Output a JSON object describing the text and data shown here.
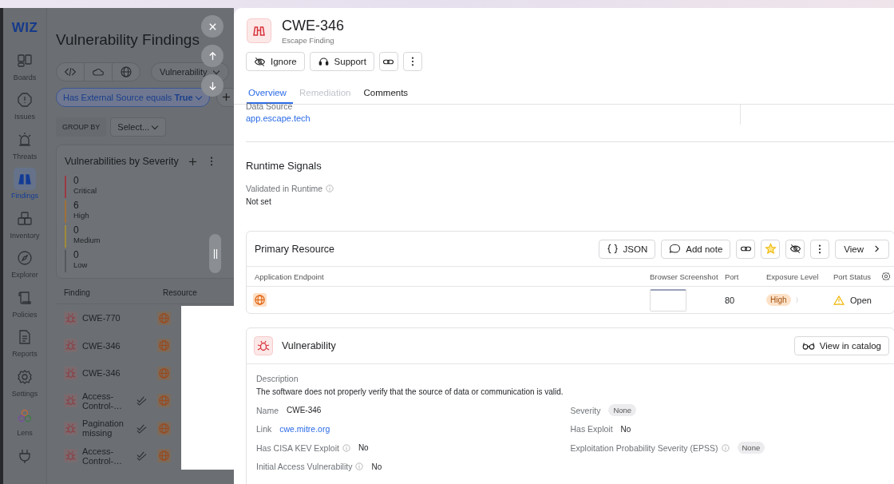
{
  "sidebar": {
    "logo": "WIZ",
    "items": [
      {
        "label": "Boards",
        "selected": false
      },
      {
        "label": "Issues",
        "selected": false
      },
      {
        "label": "Threats",
        "selected": false
      },
      {
        "label": "Findings",
        "selected": true
      },
      {
        "label": "Inventory",
        "selected": false
      },
      {
        "label": "Explorer",
        "selected": false
      },
      {
        "label": "Policies",
        "selected": false
      },
      {
        "label": "Reports",
        "selected": false
      },
      {
        "label": "Settings",
        "selected": false
      },
      {
        "label": "Lens",
        "selected": false
      },
      {
        "selected": false
      }
    ]
  },
  "page": {
    "title": "Vulnerability Findings",
    "type_filter": "Vulnerability",
    "filter_chip": "Has External Source equals **True**",
    "group_by_label": "GROUP BY",
    "group_by_value": "Select..."
  },
  "severity_card": {
    "title": "Vulnerabilities by Severity",
    "levels": [
      {
        "count": "0",
        "label": "Critical",
        "color": "#9b3a44"
      },
      {
        "count": "6",
        "label": "High",
        "color": "#a0703a"
      },
      {
        "count": "0",
        "label": "Medium",
        "color": "#a08a3a"
      },
      {
        "count": "0",
        "label": "Low",
        "color": "#55595e"
      }
    ]
  },
  "findings_table": {
    "columns": [
      "Finding",
      "Resource"
    ],
    "rows": [
      {
        "name": "CWE-770",
        "verified": false
      },
      {
        "name": "CWE-346",
        "verified": false
      },
      {
        "name": "CWE-346",
        "verified": false
      },
      {
        "name": "Access-Control-…",
        "verified": true
      },
      {
        "name": "Pagination missing",
        "verified": true
      },
      {
        "name": "Access-Control-…",
        "verified": true
      }
    ]
  },
  "drawer": {
    "title": "CWE-346",
    "subtitle": "Escape Finding",
    "actions": [
      "Ignore",
      "Support"
    ],
    "tabs": [
      {
        "label": "Overview",
        "selected": true,
        "disabled": false
      },
      {
        "label": "Remediation",
        "selected": false,
        "disabled": true
      },
      {
        "label": "Comments",
        "selected": false,
        "disabled": false
      }
    ],
    "data_source": {
      "label": "Data Source",
      "value": "app.escape.tech"
    },
    "runtime": {
      "title": "Runtime Signals",
      "label": "Validated in Runtime",
      "value": "Not set"
    },
    "primary_resource": {
      "title": "Primary Resource",
      "json_button": "JSON",
      "note_button": "Add note",
      "starred": true,
      "view_button": "View",
      "columns": [
        "Application Endpoint",
        "Browser Screenshot",
        "Port",
        "Exposure Level",
        "Port Status"
      ],
      "row": {
        "port": "80",
        "exposure": "High",
        "status": "Open"
      }
    },
    "vulnerability": {
      "title": "Vulnerability",
      "catalog_button": "View in catalog",
      "description_label": "Description",
      "description": "The software does not properly verify that the source of data or communication is valid.",
      "fields_left": [
        {
          "label": "Name",
          "value": "CWE-346",
          "kind": "text",
          "info": false
        },
        {
          "label": "Link",
          "value": "cwe.mitre.org",
          "kind": "link",
          "info": false
        },
        {
          "label": "Has CISA KEV Exploit",
          "value": "No",
          "kind": "text",
          "info": true
        },
        {
          "label": "Initial Access Vulnerability",
          "value": "No",
          "kind": "text",
          "info": true
        }
      ],
      "fields_right": [
        {
          "label": "Severity",
          "value": "None",
          "kind": "badge",
          "info": false
        },
        {
          "label": "Has Exploit",
          "value": "No",
          "kind": "text",
          "info": false
        },
        {
          "label": "Exploitation Probability Severity (EPSS)",
          "value": "None",
          "kind": "badge",
          "info": true
        }
      ]
    }
  }
}
